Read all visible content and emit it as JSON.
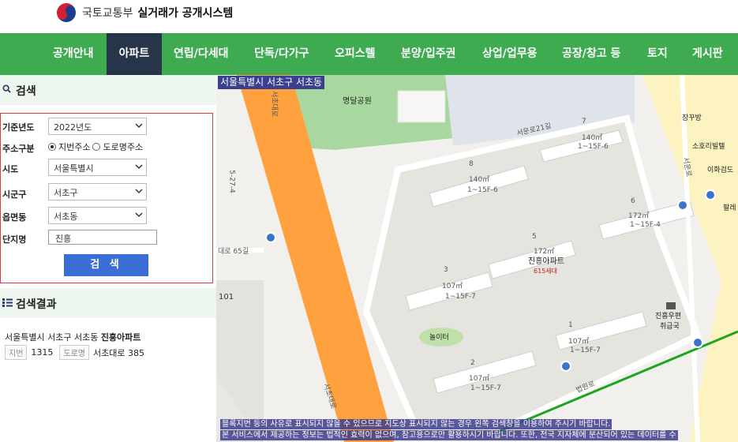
{
  "header": {
    "ministry": "국토교통부",
    "system_name": "실거래가 공개시스템"
  },
  "nav": {
    "items": [
      "공개안내",
      "아파트",
      "연립/다세대",
      "단독/다가구",
      "오피스텔",
      "분양/입주권",
      "상업/업무용",
      "공장/창고 등",
      "토지",
      "게시판"
    ],
    "active": "아파트"
  },
  "search": {
    "title": "검색",
    "year_label": "기준년도",
    "year_value": "2022년도",
    "addr_type_label": "주소구분",
    "addr_opt1": "지번주소",
    "addr_opt2": "도로명주소",
    "sido_label": "시도",
    "sido_value": "서울특별시",
    "sigungu_label": "시군구",
    "sigungu_value": "서초구",
    "dong_label": "읍면동",
    "dong_value": "서초동",
    "complex_label": "단지명",
    "complex_value": "진흥",
    "button": "검 색"
  },
  "results": {
    "title": "검색결과",
    "location": "서울특별시 서초구 서초동",
    "name": "진흥아파트",
    "jibun_tag": "지번",
    "jibun": "1315",
    "road_tag": "도로명",
    "road": "서초대로 385"
  },
  "map": {
    "title": "서울특별시 서초구 서초동",
    "park": "명달공원",
    "road_seocho21": "서운로21길",
    "road_daero65": "대로 65길",
    "road_27": "5-27-4",
    "road_seocho": "서초대로",
    "road_unnamed": "서운로",
    "road_beop": "법원로",
    "road_daero_vert": "서초대로",
    "apt_name": "진흥아파트",
    "apt_units": "615세대",
    "playground": "놀이터",
    "post_office": "진흥우편",
    "post_office2": "취급국",
    "jangbang": "장꾸방",
    "sorri": "소호리빌텔",
    "leehwa": "이화검도",
    "palle": "팔레",
    "b101": "101",
    "buildings": [
      {
        "no": "7",
        "area": "140㎡",
        "floors": "1~15F-6"
      },
      {
        "no": "8",
        "area": "140㎡",
        "floors": "1~15F-6"
      },
      {
        "no": "6",
        "area": "172㎡",
        "floors": "1~15F-4"
      },
      {
        "no": "5",
        "area": "172㎡",
        "floors": ""
      },
      {
        "no": "3",
        "area": "107㎡",
        "floors": "1~15F-7"
      },
      {
        "no": "1",
        "area": "107㎡",
        "floors": "1~15F-7"
      },
      {
        "no": "2",
        "area": "107㎡",
        "floors": "1~15F-7"
      }
    ],
    "notice1": "블록지번 등의 사유로 표시되지 않을 수 있으므로 지도상 표시되지 않는 경우 왼쪽 검색창을 이용하여 주시기 바랍니다.",
    "notice2": "본 서비스에서 제공하는 정보는 법적인 효력이 없으며, 참고용으로만 활용하시기 바랍니다. 또한, 전국 지자체에 분산되어 있는 데이터를 수"
  },
  "colors": {
    "nav_green": "#3fab51",
    "nav_active": "#27354a",
    "search_border": "#e03a3a",
    "search_button": "#3b6ed4",
    "road_orange": "#ff9f43"
  }
}
